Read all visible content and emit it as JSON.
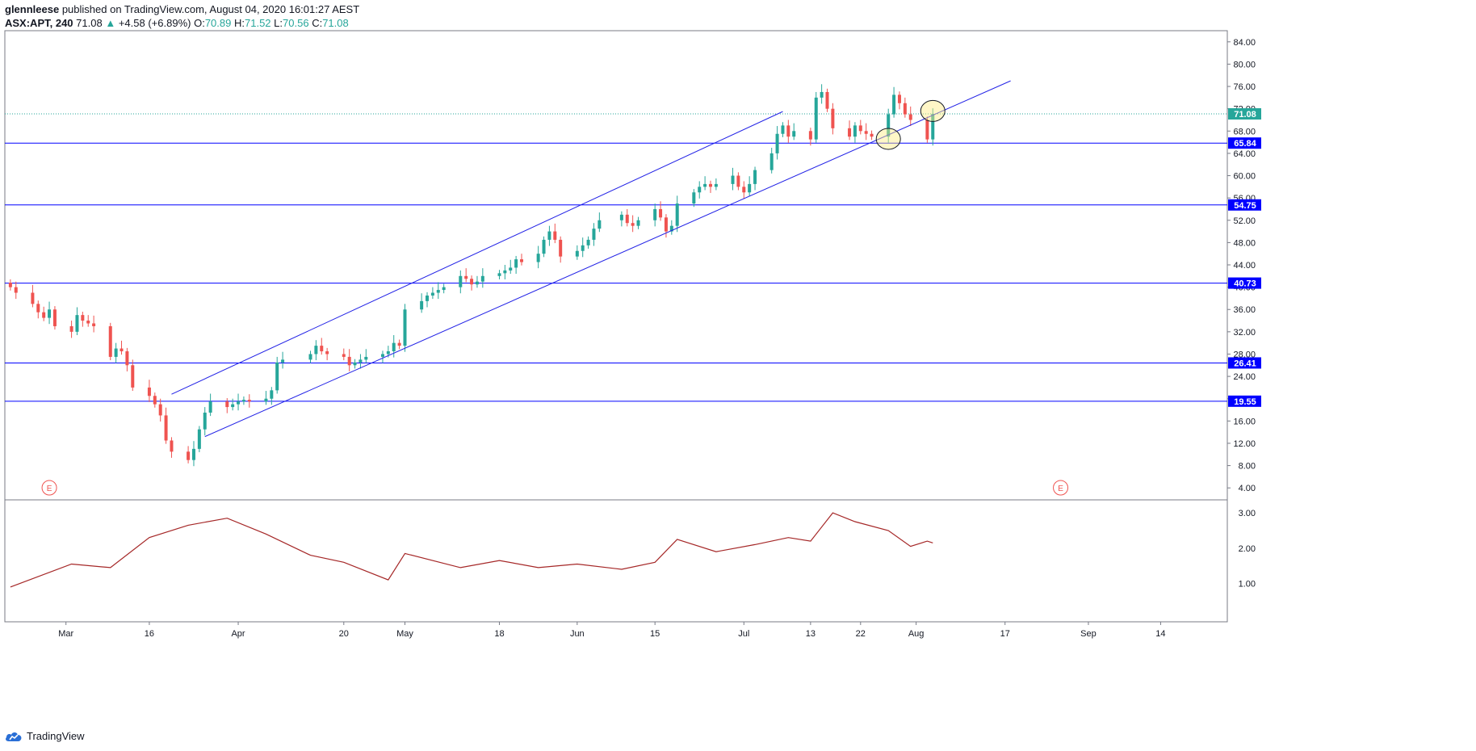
{
  "header": {
    "user": "glennleese",
    "published": " published on TradingView.com, August 04, 2020 16:01:27 AEST",
    "symbol": "ASX:APT, 240",
    "last": "71.08",
    "arrow": "▲",
    "change": "+4.58 (+6.89%)",
    "o_label": "O:",
    "o_val": "70.89",
    "h_label": "H:",
    "h_val": "71.52",
    "l_label": "L:",
    "l_val": "70.56",
    "c_label": "C:",
    "c_val": "71.08"
  },
  "brand": {
    "name": "TradingView",
    "icon": "tradingview-cloud-icon"
  },
  "colors": {
    "up": "#26a69a",
    "down": "#ef5350",
    "hline": "#0000ff",
    "channel": "#2222e6",
    "atr": "#a52727",
    "last_price": "#26a69a"
  },
  "chart_data": {
    "type": "candlestick",
    "symbol": "ASX:APT",
    "interval": "240",
    "ylim": [
      2,
      86
    ],
    "price_ticks": [
      "84.00",
      "80.00",
      "76.00",
      "72.00",
      "68.00",
      "64.00",
      "60.00",
      "56.00",
      "52.00",
      "48.00",
      "44.00",
      "40.00",
      "36.00",
      "32.00",
      "28.00",
      "24.00",
      "20.00",
      "16.00",
      "12.00",
      "8.00",
      "4.00"
    ],
    "x_ticks": [
      "Mar",
      "16",
      "Apr",
      "20",
      "May",
      "18",
      "Jun",
      "15",
      "Jul",
      "13",
      "22",
      "Aug",
      "17",
      "Sep",
      "14"
    ],
    "horizontal_levels": [
      {
        "label": "65.84",
        "value": 65.84
      },
      {
        "label": "54.75",
        "value": 54.75
      },
      {
        "label": "40.73",
        "value": 40.73
      },
      {
        "label": "26.41",
        "value": 26.41
      },
      {
        "label": "19.55",
        "value": 19.55
      }
    ],
    "last_price": {
      "label": "71.08",
      "value": 71.08
    },
    "earnings_markers": [
      "E",
      "E"
    ],
    "channel": {
      "upper": [
        [
          "2020-03-20",
          20.8
        ],
        [
          "2020-07-08",
          71.5
        ]
      ],
      "lower": [
        [
          "2020-03-26",
          13.2
        ],
        [
          "2020-08-18",
          77.0
        ]
      ]
    },
    "candles_daily_close": [
      [
        "2020-02-20",
        40.0
      ],
      [
        "2020-02-21",
        39.0
      ],
      [
        "2020-02-24",
        37.0
      ],
      [
        "2020-02-25",
        35.5
      ],
      [
        "2020-02-26",
        34.5
      ],
      [
        "2020-02-27",
        36.0
      ],
      [
        "2020-02-28",
        33.0
      ],
      [
        "2020-03-02",
        32.0
      ],
      [
        "2020-03-03",
        35.0
      ],
      [
        "2020-03-04",
        34.0
      ],
      [
        "2020-03-05",
        33.5
      ],
      [
        "2020-03-06",
        33.0
      ],
      [
        "2020-03-09",
        27.5
      ],
      [
        "2020-03-10",
        29.0
      ],
      [
        "2020-03-11",
        28.5
      ],
      [
        "2020-03-12",
        26.0
      ],
      [
        "2020-03-13",
        22.0
      ],
      [
        "2020-03-16",
        20.5
      ],
      [
        "2020-03-17",
        19.0
      ],
      [
        "2020-03-18",
        17.0
      ],
      [
        "2020-03-19",
        12.5
      ],
      [
        "2020-03-20",
        10.5
      ],
      [
        "2020-03-23",
        9.0
      ],
      [
        "2020-03-24",
        11.0
      ],
      [
        "2020-03-25",
        14.5
      ],
      [
        "2020-03-26",
        17.5
      ],
      [
        "2020-03-27",
        19.5
      ],
      [
        "2020-03-30",
        18.5
      ],
      [
        "2020-03-31",
        19.0
      ],
      [
        "2020-04-01",
        19.5
      ],
      [
        "2020-04-02",
        19.8
      ],
      [
        "2020-04-03",
        19.5
      ],
      [
        "2020-04-06",
        20.0
      ],
      [
        "2020-04-07",
        21.5
      ],
      [
        "2020-04-08",
        26.5
      ],
      [
        "2020-04-09",
        27.0
      ],
      [
        "2020-04-14",
        28.0
      ],
      [
        "2020-04-15",
        29.5
      ],
      [
        "2020-04-16",
        28.5
      ],
      [
        "2020-04-17",
        28.0
      ],
      [
        "2020-04-20",
        27.5
      ],
      [
        "2020-04-21",
        26.0
      ],
      [
        "2020-04-22",
        26.5
      ],
      [
        "2020-04-23",
        27.0
      ],
      [
        "2020-04-24",
        27.5
      ],
      [
        "2020-04-27",
        28.0
      ],
      [
        "2020-04-28",
        28.5
      ],
      [
        "2020-04-29",
        30.0
      ],
      [
        "2020-04-30",
        29.5
      ],
      [
        "2020-05-01",
        36.0
      ],
      [
        "2020-05-04",
        37.5
      ],
      [
        "2020-05-05",
        38.5
      ],
      [
        "2020-05-06",
        39.0
      ],
      [
        "2020-05-07",
        39.5
      ],
      [
        "2020-05-08",
        40.0
      ],
      [
        "2020-05-11",
        42.0
      ],
      [
        "2020-05-12",
        41.5
      ],
      [
        "2020-05-13",
        40.5
      ],
      [
        "2020-05-14",
        41.0
      ],
      [
        "2020-05-15",
        42.0
      ],
      [
        "2020-05-18",
        42.5
      ],
      [
        "2020-05-19",
        43.0
      ],
      [
        "2020-05-20",
        43.5
      ],
      [
        "2020-05-21",
        45.0
      ],
      [
        "2020-05-22",
        44.5
      ],
      [
        "2020-05-25",
        46.0
      ],
      [
        "2020-05-26",
        48.5
      ],
      [
        "2020-05-27",
        50.0
      ],
      [
        "2020-05-28",
        48.5
      ],
      [
        "2020-05-29",
        45.5
      ],
      [
        "2020-06-01",
        46.5
      ],
      [
        "2020-06-02",
        47.5
      ],
      [
        "2020-06-03",
        48.5
      ],
      [
        "2020-06-04",
        50.5
      ],
      [
        "2020-06-05",
        52.0
      ],
      [
        "2020-06-09",
        53.0
      ],
      [
        "2020-06-10",
        51.5
      ],
      [
        "2020-06-11",
        51.0
      ],
      [
        "2020-06-12",
        52.0
      ],
      [
        "2020-06-15",
        54.0
      ],
      [
        "2020-06-16",
        52.5
      ],
      [
        "2020-06-17",
        50.0
      ],
      [
        "2020-06-18",
        51.0
      ],
      [
        "2020-06-19",
        55.0
      ],
      [
        "2020-06-22",
        57.0
      ],
      [
        "2020-06-23",
        58.0
      ],
      [
        "2020-06-24",
        58.5
      ],
      [
        "2020-06-25",
        58.0
      ],
      [
        "2020-06-26",
        58.5
      ],
      [
        "2020-06-29",
        60.0
      ],
      [
        "2020-06-30",
        58.0
      ],
      [
        "2020-07-01",
        57.0
      ],
      [
        "2020-07-02",
        58.5
      ],
      [
        "2020-07-03",
        61.0
      ],
      [
        "2020-07-06",
        64.0
      ],
      [
        "2020-07-07",
        67.5
      ],
      [
        "2020-07-08",
        69.0
      ],
      [
        "2020-07-09",
        67.0
      ],
      [
        "2020-07-10",
        68.0
      ],
      [
        "2020-07-13",
        66.5
      ],
      [
        "2020-07-14",
        74.0
      ],
      [
        "2020-07-15",
        75.0
      ],
      [
        "2020-07-16",
        72.0
      ],
      [
        "2020-07-17",
        68.5
      ],
      [
        "2020-07-20",
        67.0
      ],
      [
        "2020-07-21",
        69.0
      ],
      [
        "2020-07-22",
        68.0
      ],
      [
        "2020-07-23",
        67.5
      ],
      [
        "2020-07-24",
        67.0
      ],
      [
        "2020-07-27",
        71.0
      ],
      [
        "2020-07-28",
        74.5
      ],
      [
        "2020-07-29",
        73.0
      ],
      [
        "2020-07-30",
        71.0
      ],
      [
        "2020-07-31",
        70.0
      ],
      [
        "2020-08-03",
        66.5
      ],
      [
        "2020-08-04",
        71.08
      ]
    ],
    "indicator": {
      "type": "line",
      "ylim": [
        0.6,
        3.3
      ],
      "ticks": [
        "3.00",
        "2.00",
        "1.00"
      ],
      "points": [
        [
          "2020-02-20",
          0.9
        ],
        [
          "2020-03-02",
          1.55
        ],
        [
          "2020-03-09",
          1.45
        ],
        [
          "2020-03-16",
          2.3
        ],
        [
          "2020-03-23",
          2.65
        ],
        [
          "2020-03-30",
          2.85
        ],
        [
          "2020-04-06",
          2.4
        ],
        [
          "2020-04-14",
          1.8
        ],
        [
          "2020-04-20",
          1.6
        ],
        [
          "2020-04-28",
          1.1
        ],
        [
          "2020-05-01",
          1.85
        ],
        [
          "2020-05-11",
          1.45
        ],
        [
          "2020-05-18",
          1.65
        ],
        [
          "2020-05-25",
          1.45
        ],
        [
          "2020-06-01",
          1.55
        ],
        [
          "2020-06-09",
          1.4
        ],
        [
          "2020-06-15",
          1.6
        ],
        [
          "2020-06-19",
          2.25
        ],
        [
          "2020-06-26",
          1.9
        ],
        [
          "2020-07-03",
          2.1
        ],
        [
          "2020-07-09",
          2.3
        ],
        [
          "2020-07-13",
          2.2
        ],
        [
          "2020-07-17",
          3.0
        ],
        [
          "2020-07-21",
          2.75
        ],
        [
          "2020-07-27",
          2.5
        ],
        [
          "2020-07-31",
          2.05
        ],
        [
          "2020-08-03",
          2.2
        ],
        [
          "2020-08-04",
          2.15
        ]
      ]
    }
  }
}
